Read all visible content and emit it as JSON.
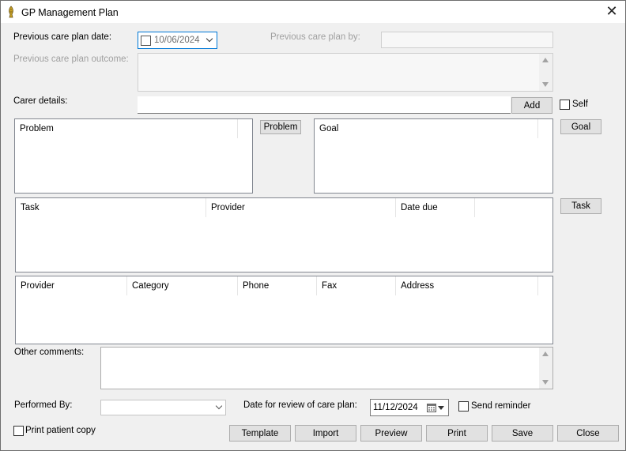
{
  "window": {
    "title": "GP Management Plan"
  },
  "form": {
    "prev_date_label": "Previous care plan date:",
    "prev_date_value": "10/06/2024",
    "prev_by_label": "Previous care plan by:",
    "prev_outcome_label": "Previous care plan outcome:",
    "carer_label": "Carer details:",
    "add_label": "Add",
    "self_label": "Self",
    "problem_btn": "Problem",
    "goal_btn": "Goal",
    "task_btn": "Task",
    "problem_list": {
      "columns": [
        "Problem"
      ]
    },
    "goal_list": {
      "columns": [
        "Goal"
      ]
    },
    "task_list": {
      "columns": [
        "Task",
        "Provider",
        "Date due"
      ]
    },
    "provider_list": {
      "columns": [
        "Provider",
        "Category",
        "Phone",
        "Fax",
        "Address"
      ]
    },
    "other_comments_label": "Other comments:",
    "performed_by_label": "Performed By:",
    "review_date_label": "Date for review of care plan:",
    "review_date_value": "11/12/2024",
    "send_reminder_label": "Send reminder",
    "print_copy_label": "Print patient copy"
  },
  "buttons": {
    "template": "Template",
    "import": "Import",
    "preview": "Preview",
    "print": "Print",
    "save": "Save",
    "close": "Close"
  },
  "icons": {
    "app": "app-logo-icon",
    "close": "close-icon",
    "dropdown": "chevron-down-icon",
    "calendar": "calendar-icon"
  }
}
